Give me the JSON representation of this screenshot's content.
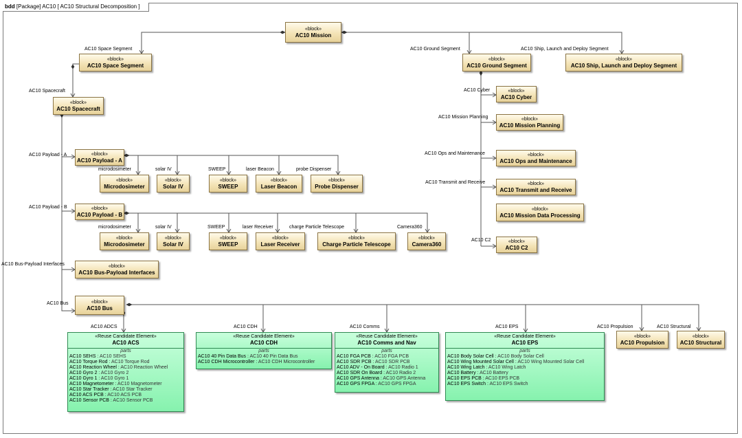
{
  "frame": {
    "kind": "bdd",
    "title": "[Package] AC10 [ AC10 Structural Decomposition ]"
  },
  "stereo": "«block»",
  "blocks": {
    "mission": "AC10 Mission",
    "space_segment": "AC10 Space Segment",
    "ground_segment": "AC10 Ground Segment",
    "ship_launch": "AC10 Ship, Launch and Deploy Segment",
    "spacecraft": "AC10 Spacecraft",
    "cyber": "AC10 Cyber",
    "mission_planning": "AC10 Mission Planning",
    "ops_maint": "AC10 Ops and Maintenance",
    "transmit_receive": "AC10 Transmit and Receive",
    "mission_data": "AC10 Mission Data Processing",
    "c2": "AC10 C2",
    "payload_a": "AC10 Payload - A",
    "payload_b": "AC10 Payload - B",
    "microdosimeter_a": "Microdosimeter",
    "solar_iv_a": "Solar IV",
    "sweep_a": "SWEEP",
    "laser_beacon": "Laser Beacon",
    "probe_dispenser": "Probe Dispenser",
    "microdosimeter_b": "Microdosimeter",
    "solar_iv_b": "Solar IV",
    "sweep_b": "SWEEP",
    "laser_receiver": "Laser Receiver",
    "charge_particle": "Charge Particle Telescope",
    "camera360": "Camera360",
    "bus_payload": "AC10 Bus-Payload Interfaces",
    "bus": "AC10 Bus",
    "propulsion": "AC10 Propulsion",
    "structural": "AC10 Structural"
  },
  "roles": {
    "space_segment": "AC10 Space Segment",
    "ground_segment": "AC10 Ground Segment",
    "ship_launch": "AC10 Ship, Launch and Deploy Segment",
    "spacecraft": "AC10 Spacecraft",
    "cyber": "AC10 Cyber",
    "mission_planning": "AC10 Mission Planning",
    "ops_maint": "AC10 Ops and Maintenance",
    "transmit_receive": "AC10 Transmit and Receive",
    "c2": "AC10 C2",
    "payload_a": "AC10 Payload - A",
    "payload_b": "AC10 Payload - B",
    "micro_a": "microdosimeter",
    "solar_a": "solar IV",
    "sweep_a": "SWEEP",
    "laser_beacon": "laser Beacon",
    "probe": "probe Dispenser",
    "micro_b": "microdosimeter",
    "solar_b": "solar IV",
    "sweep_b": "SWEEP",
    "laser_receiver": "laser Receiver",
    "charge": "charge Particle Telescope",
    "camera": "Camera360",
    "bus_payload": "AC10 Bus-Payload Interfaces",
    "bus": "AC10 Bus",
    "adcs": "AC10 ADCS",
    "cdh": "AC10 CDH",
    "comms": "AC10 Comms",
    "eps": "AC10 EPS",
    "propulsion": "AC10 Propulsion",
    "structural": "AC10 Structural"
  },
  "reuse": {
    "stereo": "«Reuse Candidate Element»",
    "parts_title": "parts",
    "acs": {
      "name": "AC10 ACS",
      "parts": [
        [
          "AC10 SEHS",
          "AC10 SEHS"
        ],
        [
          "AC10 Torque Rod",
          "AC10 Torque Rod"
        ],
        [
          "AC10 Reaction Wheel",
          "AC10 Reaction Wheel"
        ],
        [
          "AC10 Gyro 2",
          "AC10 Gyro 2"
        ],
        [
          "AC10 Gyro 1",
          "AC10 Gyro 1"
        ],
        [
          "AC10 Magnetometer",
          "AC10 Magnetometer"
        ],
        [
          "AC10 Star Tracker",
          "AC10 Star Tracker"
        ],
        [
          "AC10 ACS PCB",
          "AC10 ACS PCB"
        ],
        [
          "AC10 Sensor PCB",
          "AC10 Sensor PCB"
        ]
      ]
    },
    "cdh": {
      "name": "AC10 CDH",
      "parts": [
        [
          "AC10 40 Pin Data Bus",
          "AC10 40 Pin Data Bus"
        ],
        [
          "AC10 CDH Microcontroller",
          "AC10 CDH Microcontroller"
        ]
      ]
    },
    "comms": {
      "name": "AC10 Comms and Nav",
      "parts": [
        [
          "AC10 FGA PCB",
          "AC10 FGA PCB"
        ],
        [
          "AC10 SDR PCB",
          "AC10 SDR PCB"
        ],
        [
          "AC10 ADV - On Board",
          "AC10 Radio 1"
        ],
        [
          "AC10 SDR On Board",
          "AC10 Radio 2"
        ],
        [
          "AC10 GPS Antenna",
          "AC10 GPS Antenna"
        ],
        [
          "AC10 GPS FPGA",
          "AC10 GPS FPGA"
        ]
      ]
    },
    "eps": {
      "name": "AC10 EPS",
      "parts": [
        [
          "AC10 Body Solar Cell",
          "AC10 Body Solar Cell"
        ],
        [
          "AC10 Wing Mounted Solar Cell",
          "AC10 Wing Mounted Solar Cell"
        ],
        [
          "AC10 Wing Latch",
          "AC10 Wing Latch"
        ],
        [
          "AC10 Battery",
          "AC10 Battery"
        ],
        [
          "AC10 EPS PCB",
          "AC10 EPS PCB"
        ],
        [
          "AC10 EPS Switch",
          "AC10 EPS Switch"
        ]
      ]
    }
  }
}
